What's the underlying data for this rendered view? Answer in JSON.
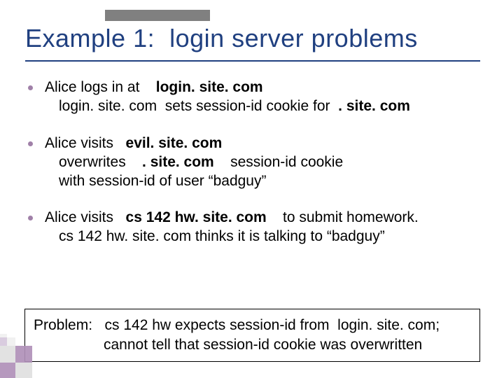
{
  "title": "Example 1:  login server problems",
  "bullets": [
    {
      "line1_a": "Alice logs in at    ",
      "line1_b": "login. site. com",
      "line2_a": "login. site. com  sets session-id cookie for  ",
      "line2_b": ". site. com"
    },
    {
      "line1_a": "Alice visits   ",
      "line1_b": "evil. site. com",
      "line2_a": "overwrites    ",
      "line2_b": ". site. com",
      "line2_c": "    session-id cookie",
      "line3": "with session-id of user “badguy”"
    },
    {
      "line1_a": "Alice visits   ",
      "line1_b": "cs 142 hw. site. com",
      "line1_c": "    to submit homework.",
      "line2": "cs 142 hw. site. com thinks it is talking to “badguy”"
    }
  ],
  "problem": {
    "line1": "Problem:   cs 142 hw expects session-id from  login. site. com;",
    "line2": "cannot tell that session-id cookie was overwritten"
  }
}
